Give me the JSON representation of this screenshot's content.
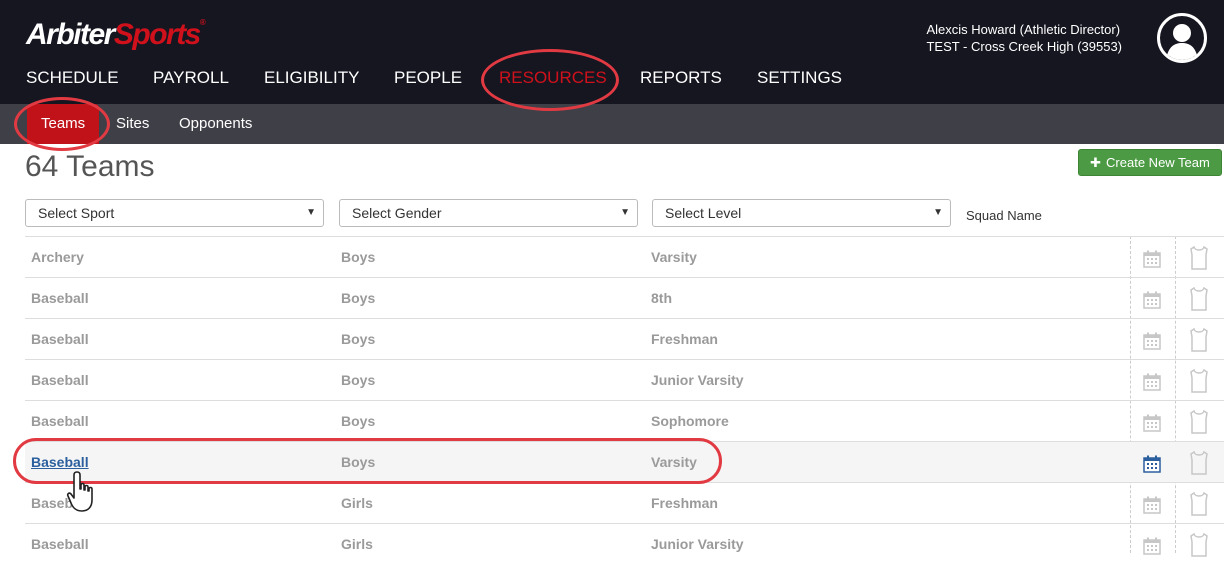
{
  "brand": {
    "logo_part1": "Arbiter",
    "logo_part2": "Sports",
    "logo_mark": "®"
  },
  "user": {
    "name_role": "Alexcis Howard (Athletic Director)",
    "org": "TEST - Cross Creek High (39553)",
    "avatar_icon": "user-silhouette-icon"
  },
  "main_nav": {
    "schedule": "SCHEDULE",
    "payroll": "PAYROLL",
    "eligibility": "ELIGIBILITY",
    "people": "PEOPLE",
    "resources": "RESOURCES",
    "reports": "REPORTS",
    "settings": "SETTINGS",
    "active": "RESOURCES"
  },
  "sub_nav": {
    "teams": "Teams",
    "sites": "Sites",
    "opponents": "Opponents",
    "active": "Teams"
  },
  "page": {
    "title": "64 Teams",
    "create_button": "Create New Team",
    "create_icon": "plus-icon"
  },
  "filters": {
    "sport": "Select Sport",
    "gender": "Select Gender",
    "level": "Select Level",
    "squad_label": "Squad Name"
  },
  "teams": [
    {
      "sport": "Archery",
      "gender": "Boys",
      "level": "Varsity"
    },
    {
      "sport": "Baseball",
      "gender": "Boys",
      "level": "8th"
    },
    {
      "sport": "Baseball",
      "gender": "Boys",
      "level": "Freshman"
    },
    {
      "sport": "Baseball",
      "gender": "Boys",
      "level": "Junior Varsity"
    },
    {
      "sport": "Baseball",
      "gender": "Boys",
      "level": "Sophomore"
    },
    {
      "sport": "Baseball",
      "gender": "Boys",
      "level": "Varsity"
    },
    {
      "sport": "Baseball",
      "gender": "Girls",
      "level": "Freshman"
    },
    {
      "sport": "Baseball",
      "gender": "Girls",
      "level": "Junior Varsity"
    }
  ],
  "colors": {
    "brand_red": "#d0111b",
    "nav_dark": "#161621",
    "subnav": "#3f3f47",
    "create_green": "#4d9a44",
    "link_blue": "#2b5f9e",
    "highlight_ring": "#e23a42"
  },
  "row_icons": {
    "calendar": "calendar-icon",
    "roster": "jersey-icon"
  }
}
